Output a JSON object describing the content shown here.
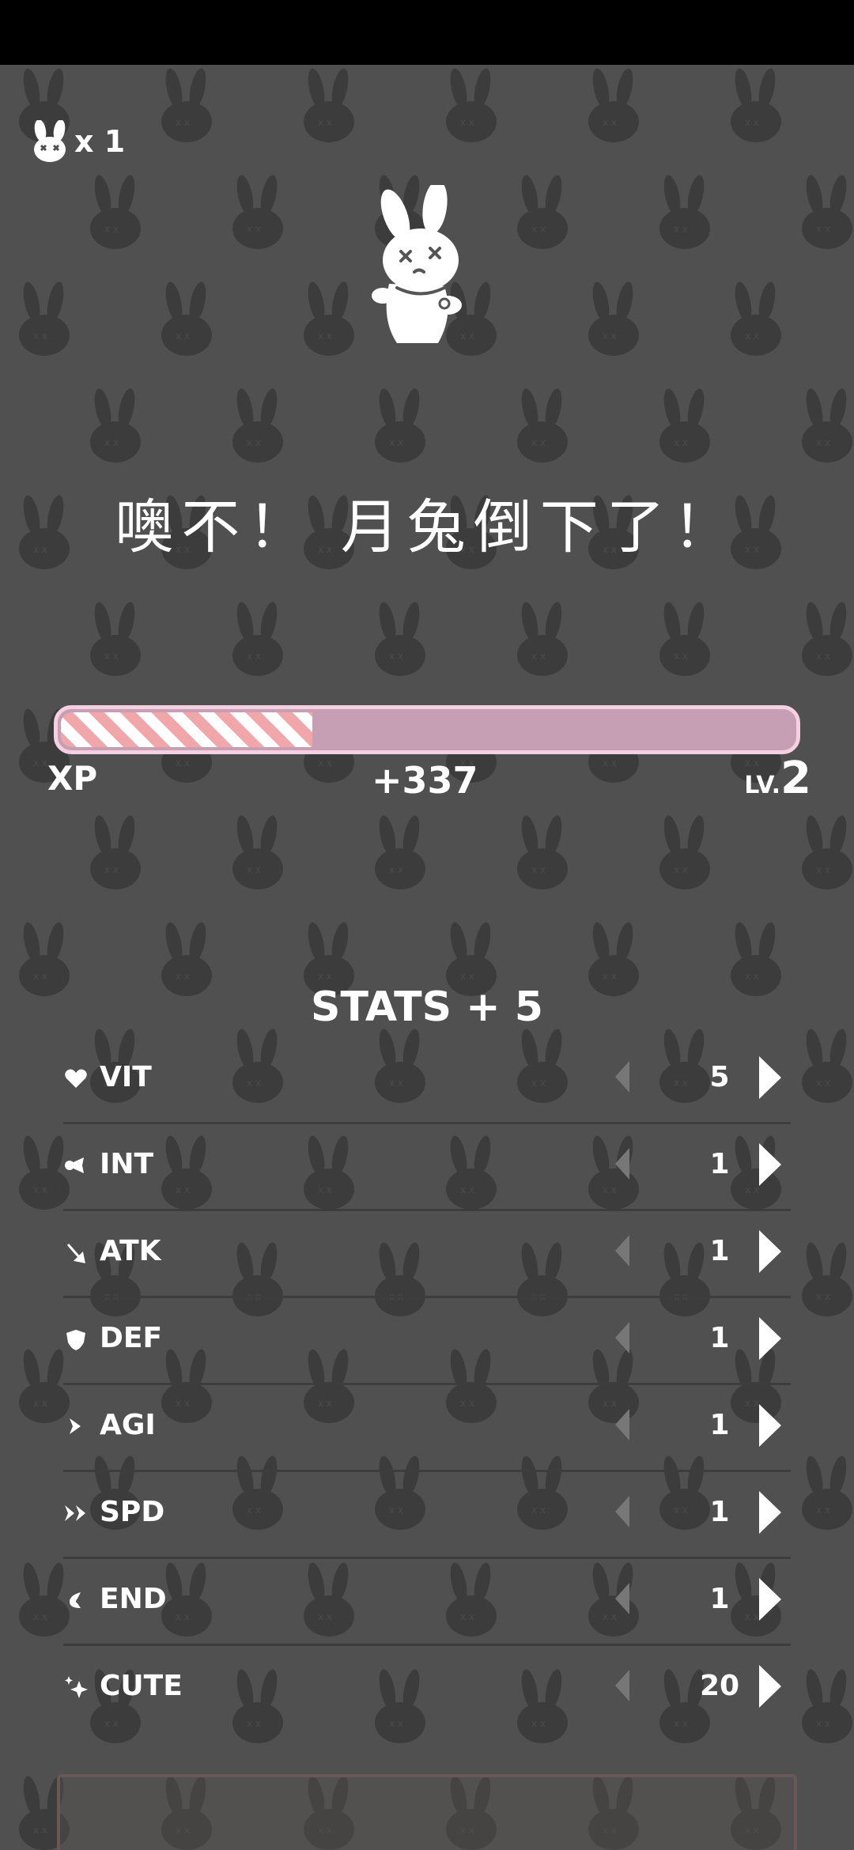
{
  "lives": {
    "count": "x 1",
    "icon": "bunny-head-icon"
  },
  "headline": "噢不！ 月兔倒下了！",
  "xp": {
    "label": "XP",
    "gain": "+337",
    "level_prefix": "LV.",
    "level": "2",
    "progress": 0.34,
    "colors": {
      "stripe_a": "#f1a7a9",
      "stripe_b": "#ffffff",
      "track": "#c69fb5",
      "border": "#f6cfe0"
    }
  },
  "stats": {
    "title": "STATS + 5",
    "rows": [
      {
        "name": "VIT",
        "value": "5",
        "icon": "heart-icon"
      },
      {
        "name": "INT",
        "value": "1",
        "icon": "brain-icon"
      },
      {
        "name": "ATK",
        "value": "1",
        "icon": "sword-icon"
      },
      {
        "name": "DEF",
        "value": "1",
        "icon": "shield-icon"
      },
      {
        "name": "AGI",
        "value": "1",
        "icon": "agility-arrow-icon"
      },
      {
        "name": "SPD",
        "value": "1",
        "icon": "double-chevron-icon"
      },
      {
        "name": "END",
        "value": "1",
        "icon": "endurance-icon"
      },
      {
        "name": "CUTE",
        "value": "20",
        "icon": "sparkle-icon"
      }
    ]
  },
  "colors": {
    "background": "#505050",
    "pattern": "#3a3a3a"
  }
}
